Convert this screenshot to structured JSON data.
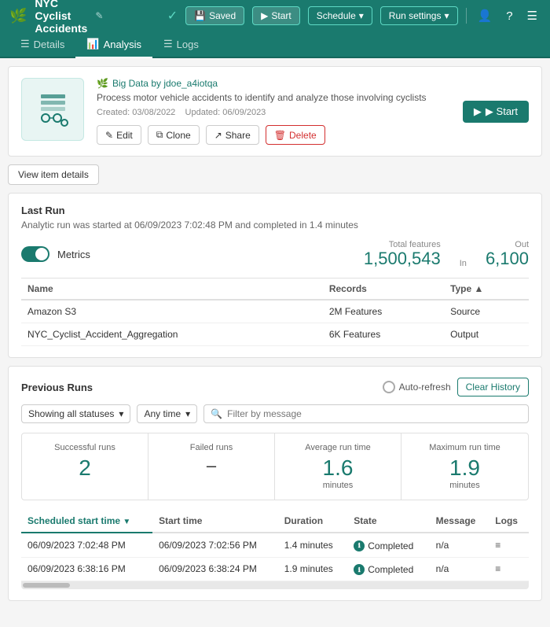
{
  "header": {
    "logo": "🌿",
    "title": "NYC Cyclist Accidents",
    "edit_icon": "✎",
    "check_icon": "✓",
    "saved_label": "Saved",
    "start_label": "Start",
    "schedule_label": "Schedule",
    "run_settings_label": "Run settings"
  },
  "tabs": [
    {
      "id": "details",
      "label": "Details",
      "icon": "☰",
      "active": false
    },
    {
      "id": "analysis",
      "label": "Analysis",
      "icon": "📊",
      "active": true
    },
    {
      "id": "logs",
      "label": "Logs",
      "icon": "☰",
      "active": false
    }
  ],
  "info_card": {
    "owner_icon": "🌿",
    "owner": "Big Data by jdoe_a4iotqa",
    "description": "Process motor vehicle accidents to identify and analyze those involving cyclists",
    "created": "Created: 03/08/2022",
    "updated": "Updated: 06/09/2023",
    "edit_label": "Edit",
    "clone_label": "Clone",
    "share_label": "Share",
    "delete_label": "Delete",
    "start_label": "▶ Start"
  },
  "view_details": {
    "label": "View item details"
  },
  "last_run": {
    "title": "Last Run",
    "subtitle": "Analytic run was started at 06/09/2023 7:02:48 PM and completed in 1.4 minutes",
    "metrics_label": "Metrics",
    "total_features_label": "Total features",
    "in_label": "In",
    "out_label": "Out",
    "total_value": "1,500,543",
    "in_value": "",
    "out_value": "6,100",
    "table": {
      "headers": [
        "Name",
        "Records",
        "Type"
      ],
      "rows": [
        {
          "name": "Amazon S3",
          "records": "2M Features",
          "type": "Source"
        },
        {
          "name": "NYC_Cyclist_Accident_Aggregation",
          "records": "6K Features",
          "type": "Output"
        }
      ]
    }
  },
  "previous_runs": {
    "title": "Previous Runs",
    "autorefresh_label": "Auto-refresh",
    "clear_history_label": "Clear History",
    "status_filter_label": "Showing all statuses",
    "time_filter_label": "Any time",
    "filter_placeholder": "Filter by message",
    "stats": {
      "successful_label": "Successful runs",
      "successful_value": "2",
      "failed_label": "Failed runs",
      "failed_value": "–",
      "avg_label": "Average run time",
      "avg_value": "1.6",
      "avg_unit": "minutes",
      "max_label": "Maximum run time",
      "max_value": "1.9",
      "max_unit": "minutes"
    },
    "table": {
      "headers": [
        {
          "label": "Scheduled start time",
          "active": true,
          "sort": "▼"
        },
        {
          "label": "Start time",
          "active": false
        },
        {
          "label": "Duration",
          "active": false
        },
        {
          "label": "State",
          "active": false
        },
        {
          "label": "Message",
          "active": false
        },
        {
          "label": "Logs",
          "active": false
        }
      ],
      "rows": [
        {
          "scheduled": "06/09/2023 7:02:48 PM",
          "start": "06/09/2023 7:02:56 PM",
          "duration": "1.4 minutes",
          "state": "Completed",
          "message": "n/a",
          "logs": "≡"
        },
        {
          "scheduled": "06/09/2023 6:38:16 PM",
          "start": "06/09/2023 6:38:24 PM",
          "duration": "1.9 minutes",
          "state": "Completed",
          "message": "n/a",
          "logs": "≡"
        }
      ]
    }
  }
}
